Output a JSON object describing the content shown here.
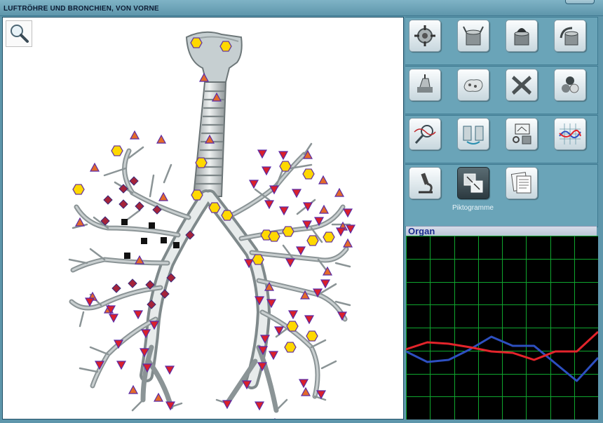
{
  "window": {
    "title": "LUFTRÖHRE UND BRONCHIEN, VON VORNE"
  },
  "viewer": {
    "zoom_icon": "magnifier-icon"
  },
  "tools": [
    {
      "icon": "target-crosshair-icon"
    },
    {
      "icon": "open-cylinder-icon"
    },
    {
      "icon": "cylinder-with-organ-icon"
    },
    {
      "icon": "arrow-cylinder-icon"
    },
    {
      "icon": "hand-device-icon"
    },
    {
      "icon": "liver-cloud-icon"
    },
    {
      "icon": "x-cross-icon"
    },
    {
      "icon": "spheres-icon"
    },
    {
      "icon": "magnifier-wave-icon"
    },
    {
      "icon": "two-cylinders-icon"
    },
    {
      "icon": "scan-machine-icon"
    },
    {
      "icon": "wave-chart-icon"
    },
    {
      "icon": "microscope-icon"
    },
    {
      "icon": "pictogram-icon",
      "active": true
    },
    {
      "icon": "documents-icon"
    }
  ],
  "selected_tool_label": "Piktogramme",
  "organ_panel": {
    "title": "Organ"
  },
  "colors": {
    "grid": "#0fa62e",
    "blue_line": "#2d4fc0",
    "red_line": "#e3242b",
    "panel": "#5e96ab"
  },
  "chart_data": {
    "type": "line",
    "title": "Organ",
    "grid": true,
    "series": [
      {
        "color": "#2d4fc0",
        "values": [
          97,
          82,
          85,
          100,
          118,
          105,
          105,
          80,
          55,
          88
        ]
      },
      {
        "color": "#e3242b",
        "values": [
          100,
          110,
          108,
          103,
          97,
          95,
          85,
          97,
          97,
          125
        ]
      }
    ]
  }
}
